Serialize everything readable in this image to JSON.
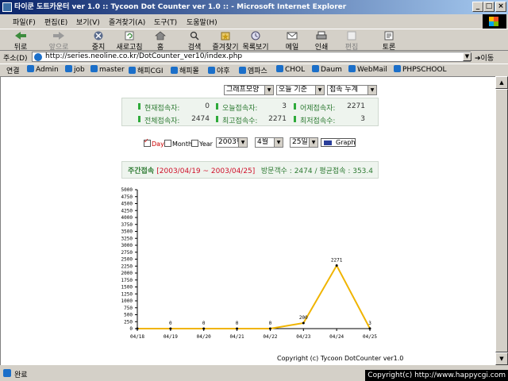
{
  "window": {
    "title": "타이쿤 도트카운터 ver 1.0 :: Tycoon Dot Counter ver 1.0 :: - Microsoft Internet Explorer"
  },
  "menu": [
    "파일(F)",
    "편집(E)",
    "보기(V)",
    "즐겨찾기(A)",
    "도구(T)",
    "도움말(H)"
  ],
  "toolbar": {
    "back": "뒤로",
    "forward": "앞으로",
    "stop": "중지",
    "refresh": "새로고침",
    "home": "홈",
    "search": "검색",
    "favorites": "즐겨찾기",
    "history": "목록보기",
    "mail": "메일",
    "print": "인쇄",
    "edit": "편집",
    "discuss": "토론"
  },
  "address": {
    "label": "주소(D)",
    "url": "http://series.neoline.co.kr/DotCounter_ver10/index.php",
    "go": "이동"
  },
  "links": {
    "label": "연결",
    "items": [
      "Admin",
      "job",
      "master",
      "해피CGI",
      "해피몰",
      "야후",
      "엠파스",
      "CHOL",
      "Daum",
      "WebMail",
      "PHPSCHOOL"
    ]
  },
  "page": {
    "selects": {
      "graph_shape": "그래프모양",
      "base": "오늘 기준",
      "mode": "접속 누계"
    },
    "stats": {
      "current_label": "현재접속자:",
      "current_value": "0",
      "today_label": "오늘접속자:",
      "today_value": "3",
      "yesterday_label": "어제접속자:",
      "yesterday_value": "2271",
      "total_label": "전체접속자:",
      "total_value": "2474",
      "max_label": "최고접속수:",
      "max_value": "2271",
      "min_label": "최저접속수:",
      "min_value": "3"
    },
    "controls": {
      "day": "Day",
      "month": "Month",
      "year": "Year",
      "year_select": "2003년",
      "month_select": "4월",
      "day_select": "25일",
      "graph_button": "Graph"
    },
    "summary": {
      "title": "주간접속",
      "range": "[2003/04/19 ~ 2003/04/25]",
      "right": "방문객수 : 2474 / 평균접속 : 353.4"
    },
    "copyright_brand": "Copyright (c) Tycoon DotCounter ver1.0"
  },
  "chart_data": {
    "type": "line",
    "categories": [
      "04/18",
      "04/19",
      "04/20",
      "04/21",
      "04/22",
      "04/23",
      "04/24",
      "04/25"
    ],
    "values": [
      0,
      0,
      0,
      0,
      0,
      200,
      2271,
      3
    ],
    "data_labels": [
      "",
      "0",
      "0",
      "0",
      "0",
      "200",
      "2271",
      "3"
    ],
    "yticks": [
      0,
      250,
      500,
      750,
      1000,
      1250,
      1500,
      1750,
      2000,
      2250,
      2500,
      2750,
      3000,
      3250,
      3500,
      3750,
      4000,
      4250,
      4500,
      4750,
      5000
    ],
    "ylim": [
      0,
      5000
    ],
    "line_color": "#f0b400",
    "grid": false
  },
  "status": {
    "text": "완료",
    "copyright": "Copyright(c) http://www.happycgi.com"
  }
}
